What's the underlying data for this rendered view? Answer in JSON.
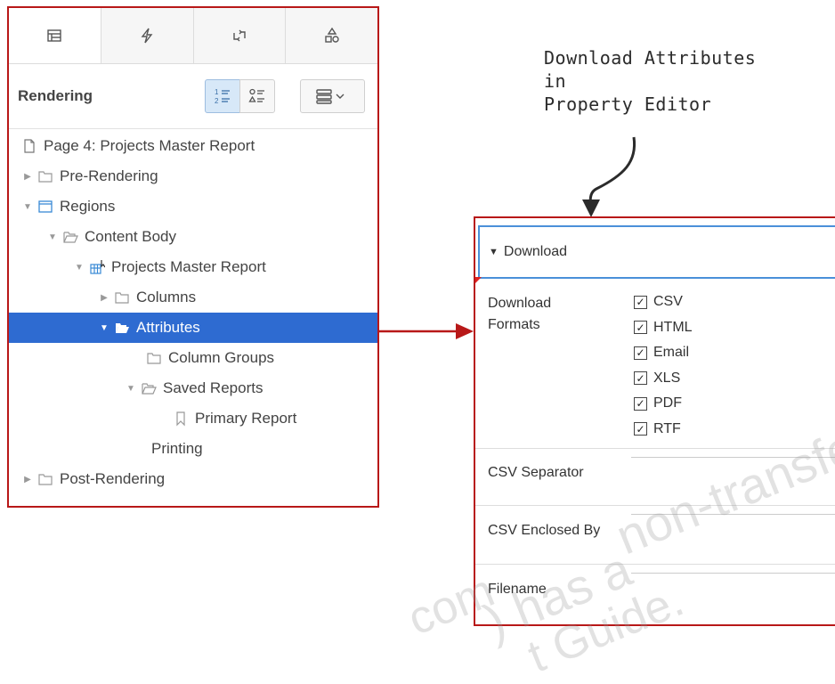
{
  "tree_panel": {
    "tabs": [
      {
        "icon": "rendering-tree-icon",
        "active": true
      },
      {
        "icon": "lightning-icon",
        "active": false
      },
      {
        "icon": "processing-arrows-icon",
        "active": false
      },
      {
        "icon": "shared-components-icon",
        "active": false
      }
    ],
    "title": "Rendering",
    "view_buttons": [
      "order-view-icon",
      "group-view-icon",
      "menu-dropdown-icon"
    ],
    "nodes": [
      {
        "label": "Page 4: Projects Master Report",
        "icon": "page-icon"
      },
      {
        "label": "Pre-Rendering",
        "icon": "folder-icon"
      },
      {
        "label": "Regions",
        "icon": "region-icon"
      },
      {
        "label": "Content Body",
        "icon": "folder-open-icon"
      },
      {
        "label": "Projects Master Report",
        "icon": "interactive-report-icon"
      },
      {
        "label": "Columns",
        "icon": "folder-icon"
      },
      {
        "label": "Attributes",
        "icon": "folder-open-icon",
        "selected": true
      },
      {
        "label": "Column Groups",
        "icon": "folder-icon"
      },
      {
        "label": "Saved Reports",
        "icon": "folder-open-icon"
      },
      {
        "label": "Primary Report",
        "icon": "bookmark-icon"
      },
      {
        "label": "Printing"
      },
      {
        "label": "Post-Rendering",
        "icon": "folder-icon"
      }
    ]
  },
  "annotation": {
    "line1": "Download Attributes",
    "line2": "in",
    "line3": "Property Editor"
  },
  "property_editor": {
    "section": "Download",
    "download_formats_label_line1": "Download",
    "download_formats_label_line2": "Formats",
    "formats": [
      {
        "label": "CSV",
        "checked": true
      },
      {
        "label": "HTML",
        "checked": true
      },
      {
        "label": "Email",
        "checked": true
      },
      {
        "label": "XLS",
        "checked": true
      },
      {
        "label": "PDF",
        "checked": true
      },
      {
        "label": "RTF",
        "checked": true
      }
    ],
    "csv_separator_label": "CSV Separator",
    "csv_enclosed_label": "CSV Enclosed By",
    "filename_label": "Filename"
  },
  "watermark": {
    "line1": "non-transfe",
    "line2": ") has a",
    "line3": "com",
    "line4": "t Guide."
  },
  "colors": {
    "selection": "#2e6bd1",
    "frame_border": "#b81818",
    "section_border": "#4a90d9",
    "folder_icon": "#9a9a9a",
    "region_icon": "#3a8ad6"
  }
}
